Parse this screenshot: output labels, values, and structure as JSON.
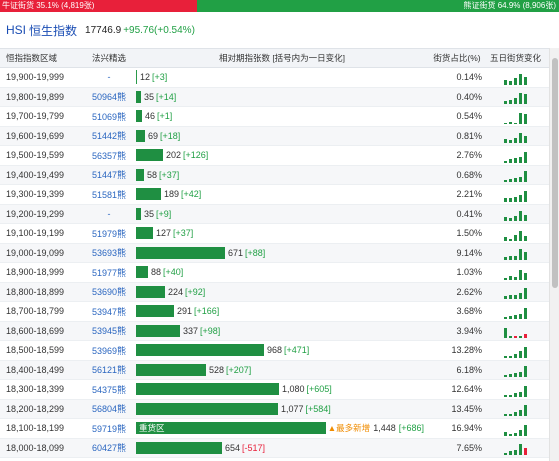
{
  "top_bar": {
    "bull_label": "牛证街货 35.1% (4,819张)",
    "bear_label": "熊证街货 64.9% (8,906张)",
    "bull_color": "#e8203a",
    "bear_color": "#21a045"
  },
  "header": {
    "code": "HSI",
    "name": "恒生指数",
    "price": "17746.9",
    "change": "+95.76(+0.54%)"
  },
  "table": {
    "columns": [
      "恒指指数区域",
      "法兴精选",
      "相对期指张数 [括号内为一日变化]",
      "街货占比(%)",
      "五日街货变化"
    ],
    "rows": [
      {
        "range": "19,900-19,999",
        "warrant": "-",
        "qty": "12",
        "delta": "[+3]",
        "pct": "0.14%",
        "bar": 0.008,
        "trend": [
          0.4,
          0.35,
          0.6,
          0.9,
          0.7
        ]
      },
      {
        "range": "19,800-19,899",
        "warrant": "50964熊",
        "qty": "35",
        "delta": "[+14]",
        "pct": "0.40%",
        "bar": 0.024,
        "trend": [
          0.25,
          0.3,
          0.5,
          0.9,
          0.8
        ]
      },
      {
        "range": "19,700-19,799",
        "warrant": "51069熊",
        "qty": "46",
        "delta": "[+1]",
        "pct": "0.54%",
        "bar": 0.032,
        "trend": [
          0.1,
          0.15,
          0.1,
          0.9,
          0.85
        ]
      },
      {
        "range": "19,600-19,699",
        "warrant": "51442熊",
        "qty": "69",
        "delta": "[+18]",
        "pct": "0.81%",
        "bar": 0.048,
        "trend": [
          0.3,
          0.25,
          0.4,
          0.85,
          0.6
        ]
      },
      {
        "range": "19,500-19,599",
        "warrant": "56357熊",
        "qty": "202",
        "delta": "[+126]",
        "pct": "2.76%",
        "bar": 0.14,
        "trend": [
          0.2,
          0.3,
          0.4,
          0.5,
          0.9
        ]
      },
      {
        "range": "19,400-19,499",
        "warrant": "51447熊",
        "qty": "58",
        "delta": "[+37]",
        "pct": "0.68%",
        "bar": 0.04,
        "trend": [
          0.2,
          0.25,
          0.3,
          0.45,
          0.9
        ]
      },
      {
        "range": "19,300-19,399",
        "warrant": "51581熊",
        "qty": "189",
        "delta": "[+42]",
        "pct": "2.21%",
        "bar": 0.13,
        "trend": [
          0.35,
          0.3,
          0.45,
          0.6,
          0.9
        ]
      },
      {
        "range": "19,200-19,299",
        "warrant": "-",
        "qty": "35",
        "delta": "[+9]",
        "pct": "0.41%",
        "bar": 0.024,
        "trend": [
          0.3,
          0.25,
          0.4,
          0.85,
          0.5
        ]
      },
      {
        "range": "19,100-19,199",
        "warrant": "51979熊",
        "qty": "127",
        "delta": "[+37]",
        "pct": "1.50%",
        "bar": 0.088,
        "trend": [
          0.3,
          0.2,
          0.5,
          0.85,
          0.4
        ]
      },
      {
        "range": "19,000-19,099",
        "warrant": "53693熊",
        "qty": "671",
        "delta": "[+88]",
        "pct": "9.14%",
        "bar": 0.466,
        "trend": [
          0.25,
          0.35,
          0.3,
          0.9,
          0.7
        ]
      },
      {
        "range": "18,900-18,999",
        "warrant": "51977熊",
        "qty": "88",
        "delta": "[+40]",
        "pct": "1.03%",
        "bar": 0.061,
        "trend": [
          0.2,
          0.3,
          0.25,
          0.85,
          0.6
        ]
      },
      {
        "range": "18,800-18,899",
        "warrant": "53690熊",
        "qty": "224",
        "delta": "[+92]",
        "pct": "2.62%",
        "bar": 0.155,
        "trend": [
          0.25,
          0.35,
          0.3,
          0.5,
          0.9
        ]
      },
      {
        "range": "18,700-18,799",
        "warrant": "53947熊",
        "qty": "291",
        "delta": "[+166]",
        "pct": "3.68%",
        "bar": 0.202,
        "trend": [
          0.2,
          0.25,
          0.3,
          0.45,
          0.9
        ]
      },
      {
        "range": "18,600-18,699",
        "warrant": "53945熊",
        "qty": "337",
        "delta": "[+98]",
        "pct": "3.94%",
        "bar": 0.234,
        "trend": [
          0.8,
          0.15,
          -0.2,
          0.2,
          -0.3
        ]
      },
      {
        "range": "18,500-18,599",
        "warrant": "53969熊",
        "qty": "968",
        "delta": "[+471]",
        "pct": "13.28%",
        "bar": 0.672,
        "trend": [
          0.15,
          0.2,
          0.3,
          0.55,
          0.9
        ]
      },
      {
        "range": "18,400-18,499",
        "warrant": "56121熊",
        "qty": "528",
        "delta": "[+207]",
        "pct": "6.18%",
        "bar": 0.367,
        "trend": [
          0.2,
          0.25,
          0.3,
          0.4,
          0.9
        ]
      },
      {
        "range": "18,300-18,399",
        "warrant": "54375熊",
        "qty": "1,080",
        "delta": "[+605]",
        "pct": "12.64%",
        "bar": 0.75,
        "trend": [
          0.15,
          0.2,
          0.3,
          0.45,
          0.9
        ]
      },
      {
        "range": "18,200-18,299",
        "warrant": "56804熊",
        "qty": "1,077",
        "delta": "[+584]",
        "pct": "13.45%",
        "bar": 0.748,
        "trend": [
          0.15,
          0.2,
          0.35,
          0.5,
          0.9
        ]
      },
      {
        "range": "18,100-18,199",
        "warrant": "59719熊",
        "qty": "1,448",
        "delta": "[+686]",
        "pct": "16.94%",
        "bar": 1.0,
        "heavy_label": "重货区",
        "badge": "▲最多新增",
        "trend": [
          0.3,
          0.2,
          0.25,
          0.5,
          0.9
        ]
      },
      {
        "range": "18,000-18,099",
        "warrant": "60427熊",
        "qty": "654",
        "delta": "[-517]",
        "pct": "7.65%",
        "bar": 0.454,
        "trend": [
          0.2,
          0.35,
          0.4,
          0.9,
          -0.6
        ]
      }
    ]
  }
}
